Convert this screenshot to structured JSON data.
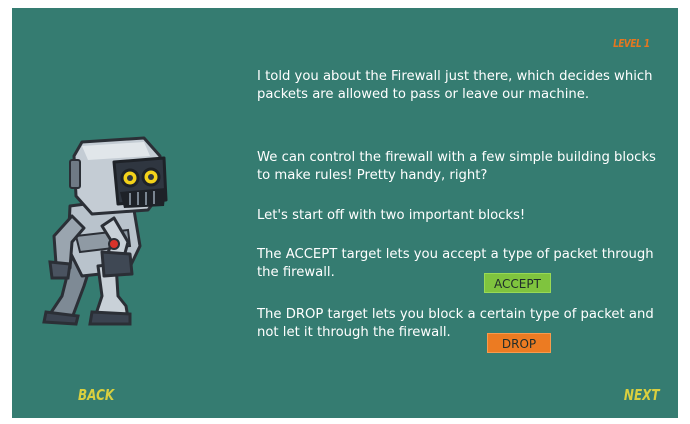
{
  "level_label": "LEVEL 1",
  "paragraphs": {
    "p1": "I told you about the Firewall just there, which decides which packets are allowed to pass or leave our machine.",
    "p2": "We can control the firewall with a few simple building blocks to make rules! Pretty handy, right?",
    "p3": "Let's start off with two important blocks!",
    "p4": "The ACCEPT target lets you accept a type of packet through the firewall.",
    "p5": "The DROP target lets you block a certain type of packet and not let it through the firewall."
  },
  "blocks": {
    "accept": "ACCEPT",
    "drop": "DROP"
  },
  "nav": {
    "back": "BACK",
    "next": "NEXT"
  },
  "colors": {
    "background": "#357c71",
    "accent_orange": "#e7771f",
    "nav_yellow": "#d9cf3f",
    "accept_green": "#7fc43e",
    "drop_orange": "#ec7b22"
  },
  "icons": {
    "character": "robot-character"
  }
}
